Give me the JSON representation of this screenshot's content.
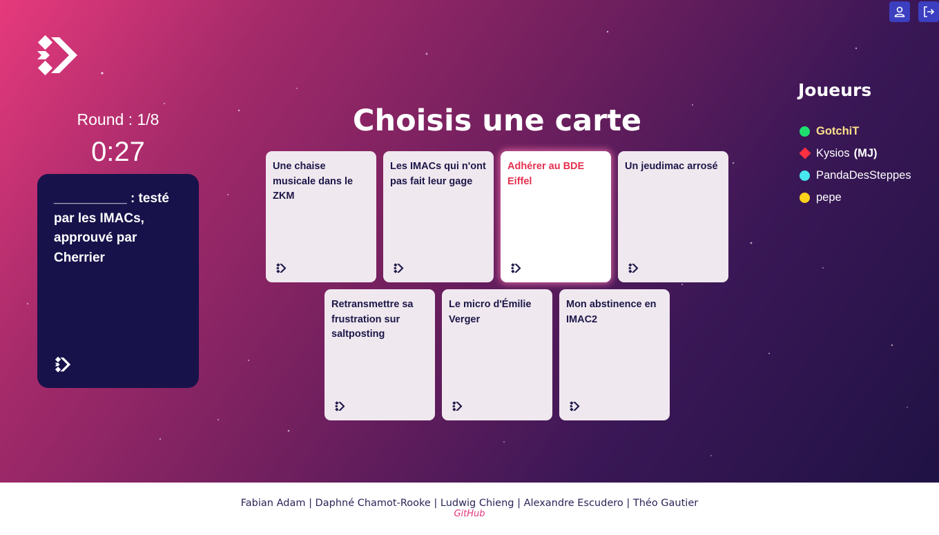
{
  "round_label": "Round : 1/8",
  "timer": "0:27",
  "black_card": "__________ : testé par les IMACs, approuvé par Cherrier",
  "title": "Choisis une carte",
  "cards": [
    {
      "text": "Une chaise musicale dans le ZKM",
      "selected": false
    },
    {
      "text": "Les IMACs qui n'ont pas fait leur gage",
      "selected": false
    },
    {
      "text": "Adhérer au BDE Eiffel",
      "selected": true
    },
    {
      "text": "Un jeudimac arrosé",
      "selected": false
    },
    {
      "text": "Retransmettre sa frustration sur saltposting",
      "selected": false
    },
    {
      "text": "Le micro d'Émilie Verger",
      "selected": false
    },
    {
      "text": "Mon abstinence en IMAC2",
      "selected": false
    }
  ],
  "players_title": "Joueurs",
  "players": [
    {
      "name": "GotchiT",
      "color": "#1fe06e",
      "shape": "circle",
      "current": true,
      "tag": ""
    },
    {
      "name": "Kysios",
      "color": "#ff3040",
      "shape": "diamond",
      "current": false,
      "tag": "(MJ)"
    },
    {
      "name": "PandaDesSteppes",
      "color": "#47e8f0",
      "shape": "circle",
      "current": false,
      "tag": ""
    },
    {
      "name": "pepe",
      "color": "#ffd21a",
      "shape": "circle",
      "current": false,
      "tag": ""
    }
  ],
  "top_icons": [
    "user-icon",
    "logout-icon"
  ],
  "footer": {
    "credits": "Fabian Adam | Daphné Chamot-Rooke | Ludwig Chieng | Alexandre Escudero | Théo Gautier",
    "github": "GitHub"
  },
  "colors": {
    "accent": "#3b3fc0",
    "card_dark": "#17124a",
    "selected_text": "#e5304f",
    "link": "#e0357c"
  }
}
